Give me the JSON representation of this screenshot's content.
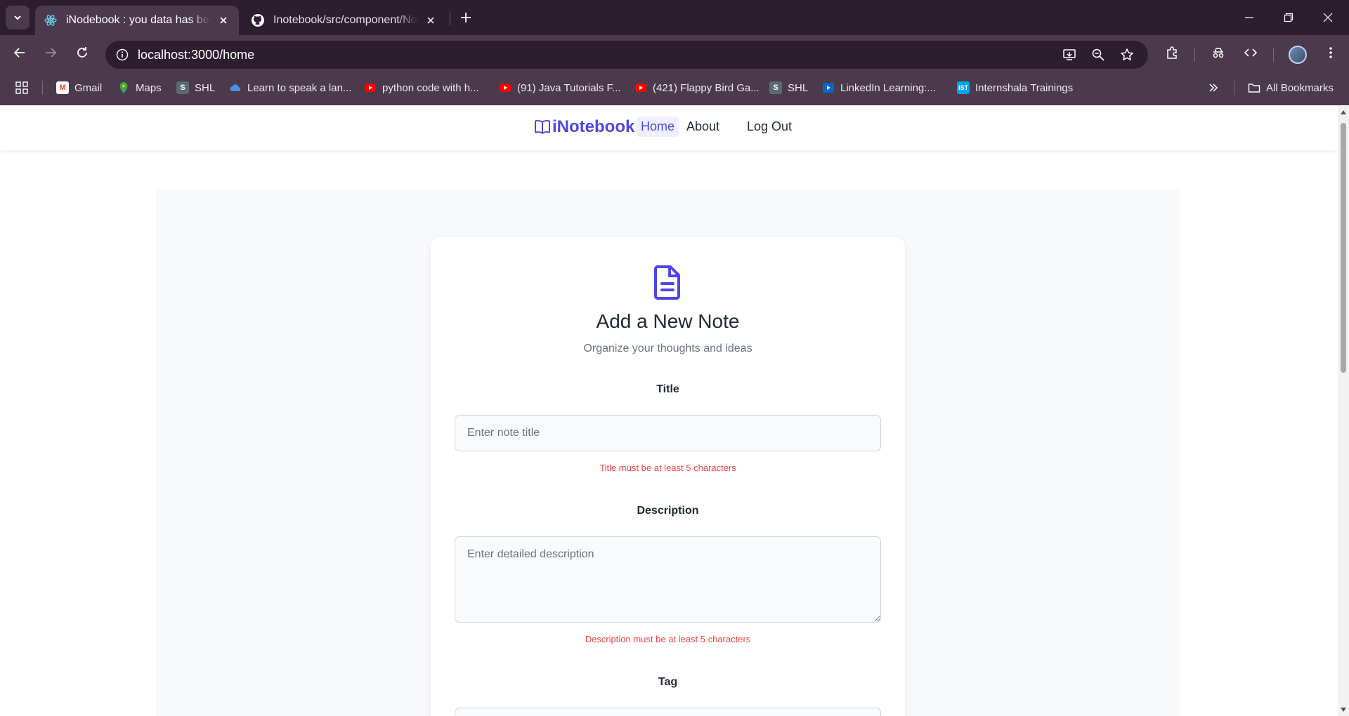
{
  "browser": {
    "tabs": [
      {
        "title": "iNodebook : you data has been saved",
        "active": true,
        "favicon": "react-icon"
      },
      {
        "title": "Inotebook/src/component/Notes.js",
        "active": false,
        "favicon": "github-icon"
      }
    ],
    "url": "localhost:3000/home",
    "bookmarks": [
      {
        "label": "Gmail",
        "icon": "gmail-icon"
      },
      {
        "label": "Maps",
        "icon": "maps-icon"
      },
      {
        "label": "SHL",
        "icon": "shl-icon"
      },
      {
        "label": "Learn to speak a lan...",
        "icon": "cloud-icon"
      },
      {
        "label": "python code with h...",
        "icon": "youtube-icon"
      },
      {
        "label": "(91) Java Tutorials F...",
        "icon": "youtube-icon"
      },
      {
        "label": "(421) Flappy Bird Ga...",
        "icon": "youtube-icon"
      },
      {
        "label": "SHL",
        "icon": "shl-icon"
      },
      {
        "label": "LinkedIn Learning:...",
        "icon": "linkedin-learning-icon"
      },
      {
        "label": "Internshala Trainings",
        "icon": "internshala-icon"
      }
    ],
    "all_bookmarks_label": "All Bookmarks"
  },
  "navbar": {
    "brand": "iNotebook",
    "links": {
      "home": "Home",
      "about": "About",
      "logout": "Log Out"
    }
  },
  "form": {
    "title": "Add a New Note",
    "subtitle": "Organize your thoughts and ideas",
    "title_field": {
      "label": "Title",
      "value": "",
      "placeholder": "Enter note title",
      "error": "Title must be at least 5 characters"
    },
    "description_field": {
      "label": "Description",
      "value": "",
      "placeholder": "Enter detailed description",
      "error": "Description must be at least 5 characters"
    },
    "tag_field": {
      "label": "Tag"
    }
  },
  "colors": {
    "accent": "#4f46e5",
    "error": "#ef4444",
    "chrome_dark": "#2d1e2f",
    "chrome_mid": "#4a3a4c"
  }
}
